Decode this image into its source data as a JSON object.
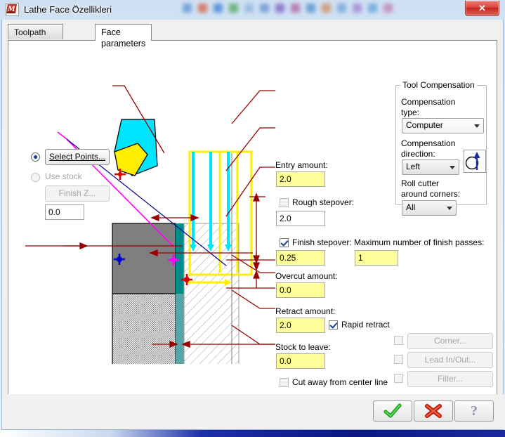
{
  "window": {
    "title": "Lathe Face Özellikleri",
    "icon": "mastercam-logo-icon",
    "close_label": "✕"
  },
  "tabs": [
    {
      "label": "Toolpath parameters",
      "active": false
    },
    {
      "label": "Face parameters",
      "active": true
    }
  ],
  "left_panel": {
    "select_points": {
      "label": "Select Points...",
      "radio_checked": true
    },
    "use_stock": {
      "label": "Use stock",
      "radio_checked": false,
      "disabled": true
    },
    "finish_z": {
      "label": "Finish Z...",
      "disabled": true
    },
    "finish_z_value": "0.0"
  },
  "fields": {
    "entry_amount": {
      "label": "Entry amount:",
      "value": "2.0",
      "highlight": true
    },
    "rough_stepover": {
      "label": "Rough stepover:",
      "value": "2.0",
      "checked": false,
      "highlight": false
    },
    "finish_stepover": {
      "label": "Finish stepover:",
      "value": "0.25",
      "checked": true,
      "highlight": true
    },
    "max_finish_passes": {
      "label": "Maximum number of finish passes:",
      "value": "1",
      "highlight": true
    },
    "overcut_amount": {
      "label": "Overcut amount:",
      "value": "0.0",
      "highlight": true
    },
    "retract_amount": {
      "label": "Retract amount:",
      "value": "2.0",
      "highlight": true
    },
    "rapid_retract": {
      "label": "Rapid retract",
      "checked": true
    },
    "stock_to_leave": {
      "label": "Stock to leave:",
      "value": "0.0",
      "highlight": true
    },
    "cut_away_center": {
      "label": "Cut away from center line",
      "checked": false
    }
  },
  "tool_compensation": {
    "group_title": "Tool Compensation",
    "type_label_line1": "Compensation",
    "type_label_line2": "type:",
    "type_value": "Computer",
    "direction_label_line1": "Compensation",
    "direction_label_line2": "direction:",
    "direction_value": "Left",
    "direction_icon": "compensation-direction-left-icon",
    "roll_label_line1": "Roll cutter",
    "roll_label_line2": "around corners:",
    "roll_value": "All"
  },
  "extra_buttons": [
    {
      "label": "Corner...",
      "checked": false,
      "disabled": true
    },
    {
      "label": "Lead In/Out...",
      "checked": false,
      "disabled": true,
      "underline_index": 0
    },
    {
      "label": "Filter...",
      "checked": false,
      "disabled": true
    }
  ],
  "dialog_buttons": [
    {
      "name": "ok-button",
      "icon": "green-check-icon"
    },
    {
      "name": "cancel-button",
      "icon": "red-x-icon"
    },
    {
      "name": "help-button",
      "icon": "question-mark-icon"
    }
  ],
  "diagram": {
    "name": "lathe-face-toolpath-diagram",
    "colors": {
      "stock": "#7f7f7f",
      "stock_hatch": "#b4b4b4",
      "tool_body": "#00e5ff",
      "tool_shank": "#1414c8",
      "tool_insert": "#ffee00",
      "teal_edge": "#008b8b",
      "cyan_pass": "#00e5ff",
      "yellow_pass": "#ffee00",
      "dimension": "#990000",
      "magenta": "#ff00ff",
      "blue_marker": "#0000cc",
      "red_marker": "#e00000"
    }
  },
  "bg_icon_colors": [
    "#5b8fd4",
    "#d4603a",
    "#3a7fd4",
    "#4fa85a",
    "#8fb4dc",
    "#6a8fd0",
    "#7a5fc0",
    "#b05fa0",
    "#4f8fc8",
    "#d08a5a",
    "#6fa0d8",
    "#9a7fd0",
    "#5f9fd8",
    "#c07fb0"
  ]
}
